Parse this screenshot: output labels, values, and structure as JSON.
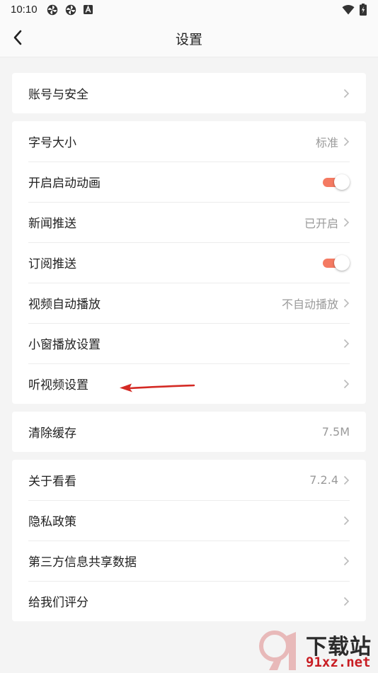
{
  "status_bar": {
    "time": "10:10",
    "icons": [
      "pinwheel-icon",
      "pinwheel-icon",
      "notification-a-icon",
      "wifi-icon",
      "battery-icon"
    ]
  },
  "header": {
    "title": "设置",
    "back_icon": "back-arrow-icon"
  },
  "groups": {
    "account": {
      "items": [
        {
          "label": "账号与安全",
          "type": "link"
        }
      ]
    },
    "general": {
      "items": [
        {
          "label": "字号大小",
          "value": "标准",
          "type": "link"
        },
        {
          "label": "开启启动动画",
          "type": "toggle",
          "on": true
        },
        {
          "label": "新闻推送",
          "value": "已开启",
          "type": "link"
        },
        {
          "label": "订阅推送",
          "type": "toggle",
          "on": true
        },
        {
          "label": "视频自动播放",
          "value": "不自动播放",
          "type": "link"
        },
        {
          "label": "小窗播放设置",
          "type": "link"
        },
        {
          "label": "听视频设置",
          "type": "link"
        }
      ]
    },
    "cache": {
      "items": [
        {
          "label": "清除缓存",
          "value": "7.5M",
          "type": "value"
        }
      ]
    },
    "about": {
      "items": [
        {
          "label": "关于看看",
          "value": "7.2.4",
          "type": "link"
        },
        {
          "label": "隐私政策",
          "type": "link"
        },
        {
          "label": "第三方信息共享数据",
          "type": "link"
        },
        {
          "label": "给我们评分",
          "type": "link"
        }
      ]
    }
  },
  "colors": {
    "accent": "#f47a62",
    "annotation_arrow": "#d42a24",
    "background": "#f4f4f4"
  },
  "watermark": {
    "brand": "下载站",
    "url": "91xz.net",
    "logo_icon": "91-logo-icon"
  }
}
